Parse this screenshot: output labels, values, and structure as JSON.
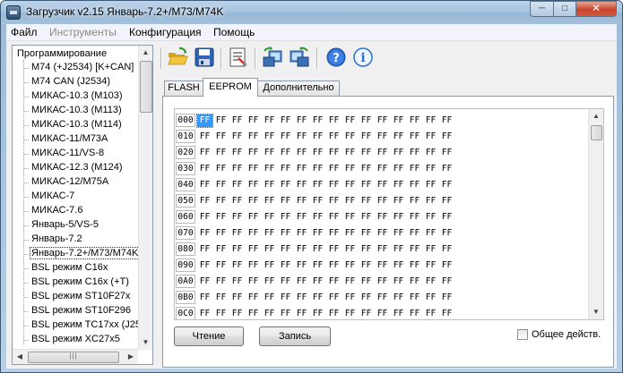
{
  "window": {
    "title": "Загрузчик v2.15 Январь-7.2+/M73/M74K",
    "min_glyph": "─",
    "max_glyph": "□",
    "close_glyph": "✕"
  },
  "menu": {
    "items": [
      {
        "label": "Файл",
        "enabled": true
      },
      {
        "label": "Инструменты",
        "enabled": false
      },
      {
        "label": "Конфигурация",
        "enabled": true
      },
      {
        "label": "Помощь",
        "enabled": true
      }
    ]
  },
  "tree": {
    "root": "Программирование",
    "items": [
      "M74 (+J2534) [K+CAN]",
      "M74 CAN (J2534)",
      "МИКАС-10.3 (M103)",
      "МИКАС-10.3 (M113)",
      "МИКАС-10.3 (M114)",
      "МИКАС-11/M73A",
      "МИКАС-11/VS-8",
      "МИКАС-12.3 (M124)",
      "МИКАС-12/M75A",
      "МИКАС-7",
      "МИКАС-7.6",
      "Январь-5/VS-5",
      "Январь-7.2",
      "Январь-7.2+/M73/M74K",
      "BSL режим C16x",
      "BSL режим C16x (+T)",
      "BSL режим ST10F27x",
      "BSL режим ST10F296",
      "BSL режим TC17xx (J25",
      "BSL режим XC27x5"
    ],
    "selected_index": 13,
    "scroll_glyphs": {
      "up": "▲",
      "down": "▼",
      "left": "◀",
      "right": "▶",
      "grip": "|||"
    }
  },
  "toolbar": {
    "buttons": [
      {
        "name": "open-folder-icon"
      },
      {
        "name": "save-icon"
      },
      {
        "name": "settings-list-icon"
      },
      {
        "name": "read-ecu-icon"
      },
      {
        "name": "write-ecu-icon"
      },
      {
        "name": "help-icon",
        "glyph": "?"
      },
      {
        "name": "info-icon",
        "glyph": "i"
      }
    ]
  },
  "tabs": [
    {
      "label": "FLASH",
      "active": false
    },
    {
      "label": "EEPROM",
      "active": true
    },
    {
      "label": "Дополнительно",
      "active": false
    }
  ],
  "hex": {
    "addresses": [
      "000",
      "010",
      "020",
      "030",
      "040",
      "050",
      "060",
      "070",
      "080",
      "090",
      "0A0",
      "0B0",
      "0C0"
    ],
    "byte_value": "FF",
    "bytes_per_row": 16,
    "selected_row": 0,
    "selected_col": 0
  },
  "buttons": {
    "read": "Чтение",
    "write": "Запись"
  },
  "checkbox": {
    "label": "Общее действ.",
    "checked": false
  },
  "colors": {
    "selection": "#3399ff",
    "close_button": "#c7452c"
  }
}
